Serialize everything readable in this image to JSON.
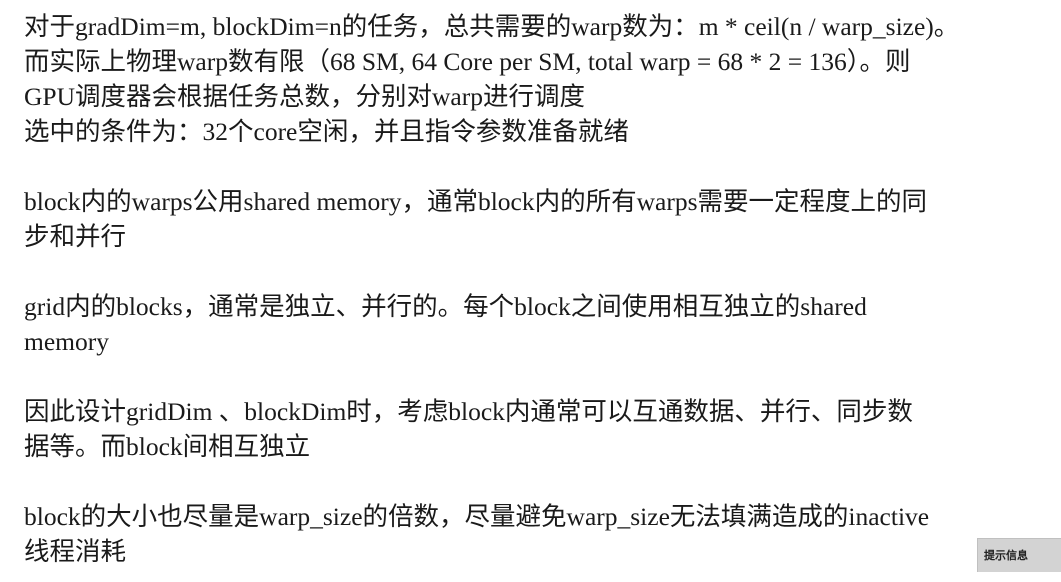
{
  "paragraphs": [
    {
      "lines": [
        "对于gradDim=m, blockDim=n的任务，总共需要的warp数为：m * ceil(n / warp_size)。",
        "而实际上物理warp数有限（68 SM, 64 Core per SM, total warp = 68 * 2 = 136）。则",
        "GPU调度器会根据任务总数，分别对warp进行调度",
        "选中的条件为：32个core空闲，并且指令参数准备就绪"
      ]
    },
    {
      "lines": [
        "block内的warps公用shared memory，通常block内的所有warps需要一定程度上的同",
        "步和并行"
      ]
    },
    {
      "lines": [
        "grid内的blocks，通常是独立、并行的。每个block之间使用相互独立的shared",
        "memory"
      ]
    },
    {
      "lines": [
        "因此设计gridDim 、blockDim时，考虑block内通常可以互通数据、并行、同步数",
        "据等。而block间相互独立"
      ]
    },
    {
      "lines": [
        "block的大小也尽量是warp_size的倍数，尽量避免warp_size无法填满造成的inactive",
        "线程消耗"
      ]
    }
  ],
  "tip": {
    "label": "提示信息"
  }
}
